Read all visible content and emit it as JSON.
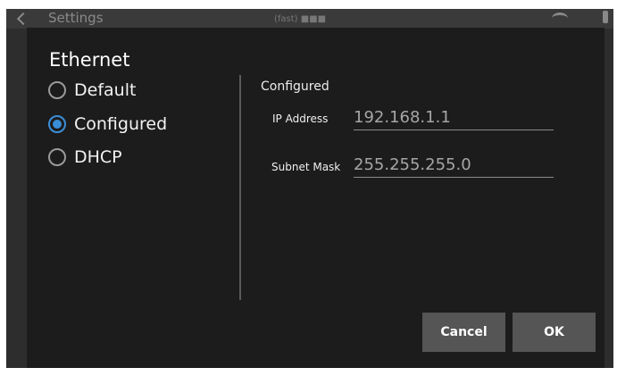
{
  "background": {
    "title": "Settings",
    "status_text": "(fast) ■■■"
  },
  "dialog": {
    "title": "Ethernet",
    "options": [
      {
        "label": "Default",
        "checked": false
      },
      {
        "label": "Configured",
        "checked": true
      },
      {
        "label": "DHCP",
        "checked": false
      }
    ],
    "section_label": "Configured",
    "fields": {
      "ip_label": "IP Address",
      "ip_value": "192.168.1.1",
      "mask_label": "Subnet Mask",
      "mask_value": "255.255.255.0"
    },
    "buttons": {
      "cancel": "Cancel",
      "ok": "OK"
    }
  },
  "colors": {
    "accent": "#3a8ed8",
    "dialog_bg": "#1c1c1c",
    "button_bg": "#555555"
  }
}
